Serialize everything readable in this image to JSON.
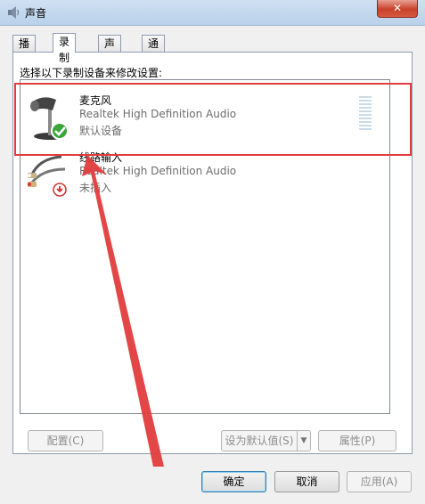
{
  "window": {
    "title": "声音",
    "close_label": "✕"
  },
  "tabs": [
    {
      "label": "播放",
      "active": false
    },
    {
      "label": "录制",
      "active": true
    },
    {
      "label": "声音",
      "active": false
    },
    {
      "label": "通信",
      "active": false
    }
  ],
  "instruction": "选择以下录制设备来修改设置:",
  "devices": [
    {
      "name": "麦克风",
      "driver": "Realtek High Definition Audio",
      "status": "默认设备",
      "icon": "microphone-icon",
      "badge": "check-badge-icon"
    },
    {
      "name": "线路输入",
      "driver": "Realtek High Definition Audio",
      "status": "未插入",
      "icon": "line-in-cable-icon",
      "badge": "unplugged-badge-icon"
    }
  ],
  "buttons": {
    "configure": "配置(C)",
    "set_default": "设为默认值(S)",
    "properties": "属性(P)",
    "ok": "确定",
    "cancel": "取消",
    "apply": "应用(A)"
  },
  "annotation_colors": {
    "highlight": "#e23c3c",
    "arrow": "#e23c3c"
  }
}
